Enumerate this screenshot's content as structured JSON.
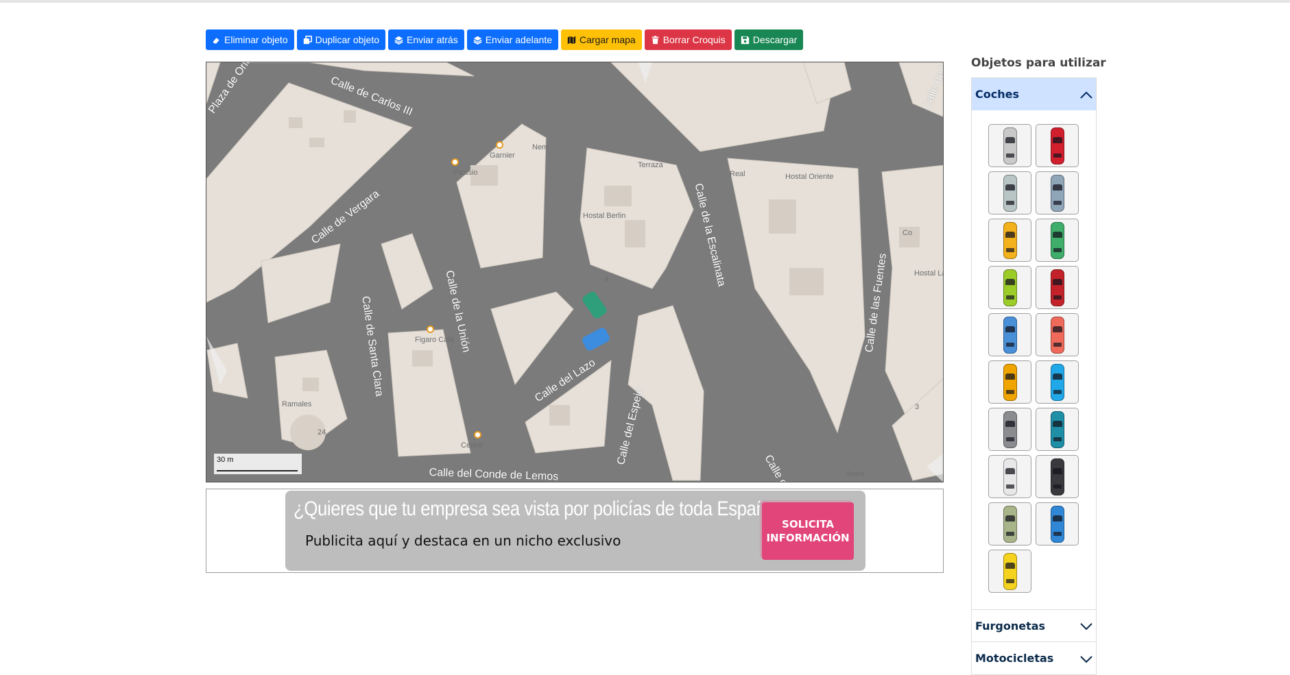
{
  "toolbar": {
    "delete": "Eliminar objeto",
    "duplicate": "Duplicar objeto",
    "send_back": "Enviar atrás",
    "send_forward": "Enviar adelante",
    "load_map": "Cargar mapa",
    "clear": "Borrar Croquis",
    "download": "Descargar"
  },
  "map": {
    "streets": [
      "Calle de Carlos III",
      "Calle de Vergara",
      "Calle de la Unión",
      "Calle de Santa Clara",
      "Calle de la Escalinata",
      "Calle de las Fuentes",
      "Calle del Lazo",
      "Calle del Espejo",
      "Calle del Conde de Lemos",
      "Plaza de Oriente",
      "Calle de la",
      "Calle d"
    ],
    "pois": [
      "Garnier",
      "Nem",
      "Picasio",
      "Hostal Berlin",
      "Terraza",
      "Real",
      "Hostal Oriente",
      "Co",
      "Hostal Las Fuente",
      "Figaro Café",
      "Cereal",
      "Ramales",
      "Aram",
      "24",
      "3",
      "4"
    ],
    "scale": "30 m"
  },
  "ad": {
    "title": "¿Quieres que tu empresa sea vista por policías de toda España?",
    "subtitle": "Publicita aquí y destaca en un nicho exclusivo",
    "button_line1": "SOLICITA",
    "button_line2": "INFORMACIÓN"
  },
  "sidebar": {
    "title": "Objetos para utilizar",
    "sections": [
      "Coches",
      "Furgonetas",
      "Motocicletas"
    ],
    "car_colors": [
      "#c9c9c9",
      "#d11f2e",
      "#b9c4c4",
      "#8fa5b8",
      "#f3b21b",
      "#3fae6a",
      "#9ccc28",
      "#c4222a",
      "#4a90d9",
      "#ef6a5a",
      "#f0a400",
      "#20a8e8",
      "#8a8c90",
      "#1f8fa8",
      "#e8e8e8",
      "#3a3a3e",
      "#a8b48a",
      "#2f87d6",
      "#f4d21e"
    ]
  }
}
